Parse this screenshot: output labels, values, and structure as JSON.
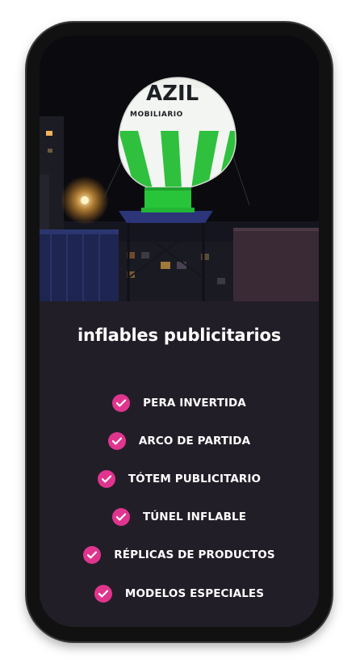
{
  "hero": {
    "balloon_text_top": "AZIL",
    "balloon_text_bottom": "MOBILIARIO",
    "colors": {
      "balloon_green": "#2fc03e",
      "balloon_white": "#f3f5f2",
      "night_sky": "#0b0b10"
    }
  },
  "section": {
    "title": "inflables publicitarios"
  },
  "items": [
    {
      "label": "PERA INVERTIDA",
      "icon": "check-circle-icon"
    },
    {
      "label": "ARCO DE PARTIDA",
      "icon": "check-circle-icon"
    },
    {
      "label": "TÓTEM PUBLICITARIO",
      "icon": "check-circle-icon"
    },
    {
      "label": "TÚNEL INFLABLE",
      "icon": "check-circle-icon"
    },
    {
      "label": "RÉPLICAS DE PRODUCTOS",
      "icon": "check-circle-icon"
    },
    {
      "label": "MODELOS ESPECIALES",
      "icon": "check-circle-icon"
    }
  ],
  "colors": {
    "accent": "#e0358e",
    "panel_background": "#221e27",
    "text": "#ffffff"
  }
}
